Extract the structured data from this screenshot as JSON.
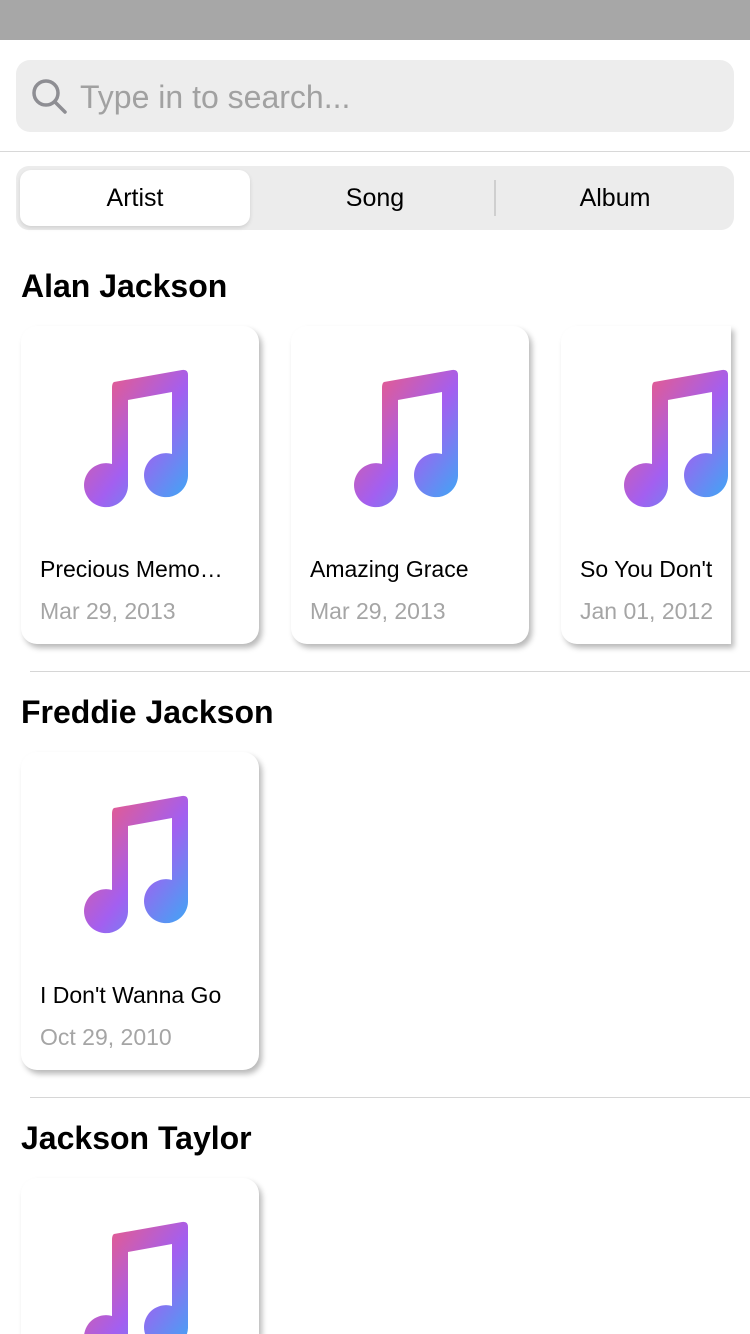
{
  "search": {
    "placeholder": "Type in to search..."
  },
  "segments": [
    {
      "label": "Artist",
      "active": true
    },
    {
      "label": "Song",
      "active": false
    },
    {
      "label": "Album",
      "active": false
    }
  ],
  "sections": [
    {
      "artist": "Alan Jackson",
      "songs": [
        {
          "title": "Precious Memo…",
          "date": "Mar 29, 2013"
        },
        {
          "title": "Amazing Grace",
          "date": "Mar 29, 2013"
        },
        {
          "title": "So You Don't",
          "date": "Jan 01, 2012"
        }
      ]
    },
    {
      "artist": "Freddie Jackson",
      "songs": [
        {
          "title": "I Don't Wanna Go",
          "date": "Oct 29, 2010"
        }
      ]
    },
    {
      "artist": "Jackson Taylor",
      "songs": [
        {
          "title": "",
          "date": ""
        }
      ]
    }
  ],
  "colors": {
    "status_bar": "#a7a7a7",
    "note_gradient_top": "#fb5c74",
    "note_gradient_mid": "#a45cf6",
    "note_gradient_bottom": "#3ca8f6",
    "date_text": "#a5a5a5"
  },
  "icons": {
    "search": "search-icon",
    "artwork": "music-note-icon"
  }
}
